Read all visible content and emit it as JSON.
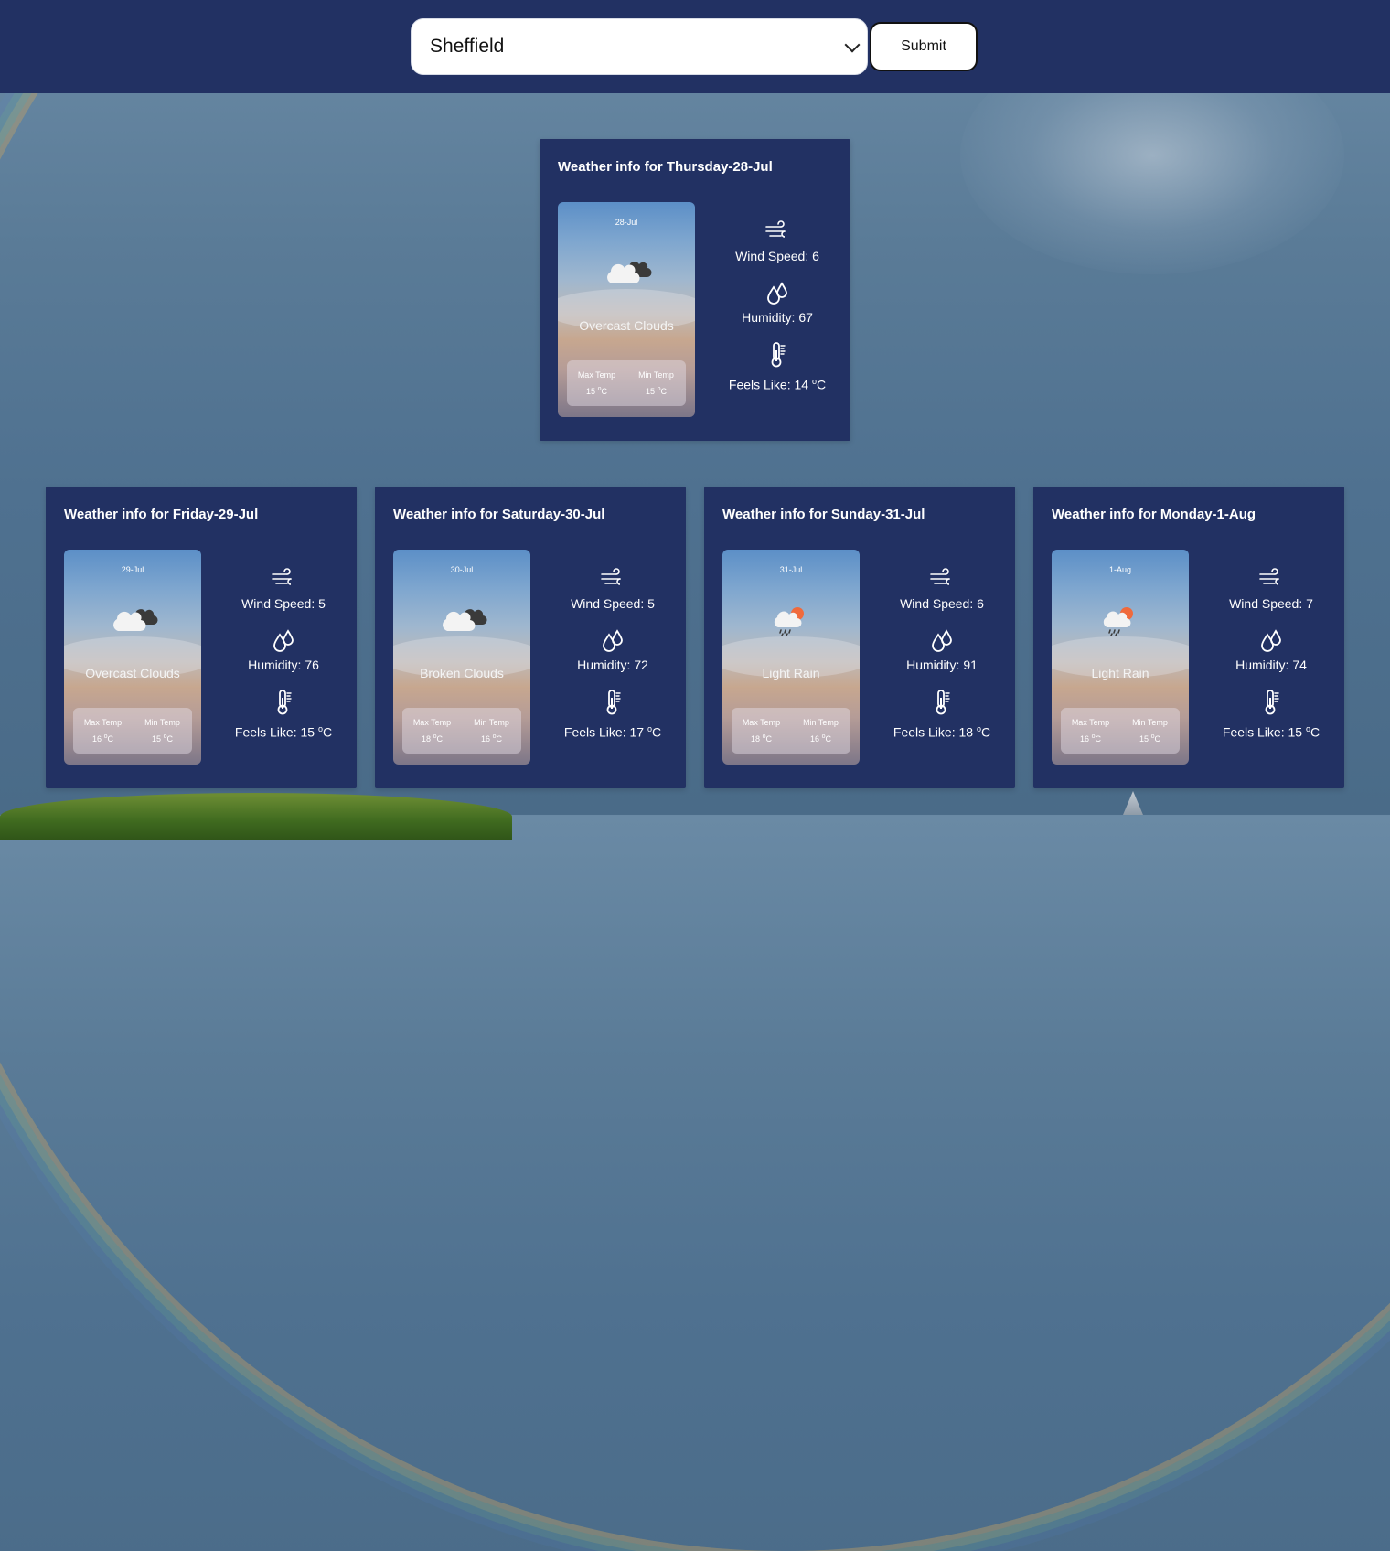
{
  "header": {
    "city_select": {
      "selected": "Sheffield"
    },
    "submit_label": "Submit"
  },
  "cards": [
    {
      "title": "Weather info for Thursday-28-Jul",
      "date": "28-Jul",
      "icon": "overcast-clouds-icon",
      "description": "Overcast Clouds",
      "max_label": "Max Temp",
      "max_temp": "15",
      "min_label": "Min Temp",
      "min_temp": "15",
      "wind": "Wind Speed: 6",
      "humidity": "Humidity: 67",
      "feels_prefix": "Feels Like: 14",
      "unit_sup": "o",
      "unit": "C"
    },
    {
      "title": "Weather info for Friday-29-Jul",
      "date": "29-Jul",
      "icon": "overcast-clouds-icon",
      "description": "Overcast Clouds",
      "max_label": "Max Temp",
      "max_temp": "16",
      "min_label": "Min Temp",
      "min_temp": "15",
      "wind": "Wind Speed: 5",
      "humidity": "Humidity: 76",
      "feels_prefix": "Feels Like: 15",
      "unit_sup": "o",
      "unit": "C"
    },
    {
      "title": "Weather info for Saturday-30-Jul",
      "date": "30-Jul",
      "icon": "broken-clouds-icon",
      "description": "Broken Clouds",
      "max_label": "Max Temp",
      "max_temp": "18",
      "min_label": "Min Temp",
      "min_temp": "16",
      "wind": "Wind Speed: 5",
      "humidity": "Humidity: 72",
      "feels_prefix": "Feels Like: 17",
      "unit_sup": "o",
      "unit": "C"
    },
    {
      "title": "Weather info for Sunday-31-Jul",
      "date": "31-Jul",
      "icon": "light-rain-icon",
      "description": "Light Rain",
      "max_label": "Max Temp",
      "max_temp": "18",
      "min_label": "Min Temp",
      "min_temp": "16",
      "wind": "Wind Speed: 6",
      "humidity": "Humidity: 91",
      "feels_prefix": "Feels Like: 18",
      "unit_sup": "o",
      "unit": "C"
    },
    {
      "title": "Weather info for Monday-1-Aug",
      "date": "1-Aug",
      "icon": "light-rain-icon",
      "description": "Light Rain",
      "max_label": "Max Temp",
      "max_temp": "16",
      "min_label": "Min Temp",
      "min_temp": "15",
      "wind": "Wind Speed: 7",
      "humidity": "Humidity: 74",
      "feels_prefix": "Feels Like: 15",
      "unit_sup": "o",
      "unit": "C"
    }
  ],
  "colors": {
    "header_bg": "#223163",
    "card_bg": "#223163"
  }
}
